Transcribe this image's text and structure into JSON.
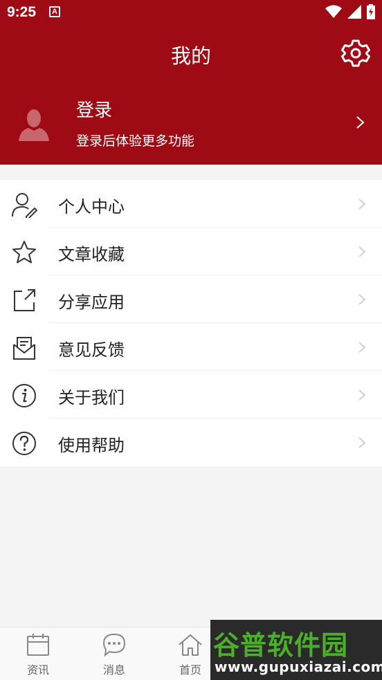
{
  "status_bar": {
    "time": "9:25",
    "notification_glyph": "A"
  },
  "header": {
    "title": "我的",
    "profile": {
      "name": "登录",
      "subtitle": "登录后体验更多功能"
    }
  },
  "menu": {
    "items": [
      {
        "label": "个人中心",
        "icon": "person-edit-icon"
      },
      {
        "label": "文章收藏",
        "icon": "star-icon"
      },
      {
        "label": "分享应用",
        "icon": "share-icon"
      },
      {
        "label": "意见反馈",
        "icon": "feedback-mail-icon"
      },
      {
        "label": "关于我们",
        "icon": "info-icon"
      },
      {
        "label": "使用帮助",
        "icon": "help-icon"
      }
    ]
  },
  "tabbar": {
    "items": [
      {
        "label": "资讯",
        "icon": "calendar-icon"
      },
      {
        "label": "消息",
        "icon": "chat-bubble-icon"
      },
      {
        "label": "首页",
        "icon": "home-icon"
      }
    ]
  },
  "watermark": {
    "name": "谷普软件园",
    "url": "www.gupuxiazai.com"
  },
  "colors": {
    "brand": "#9e0b14",
    "background": "#f4f4f4",
    "watermark_green": "#4caf2a"
  }
}
